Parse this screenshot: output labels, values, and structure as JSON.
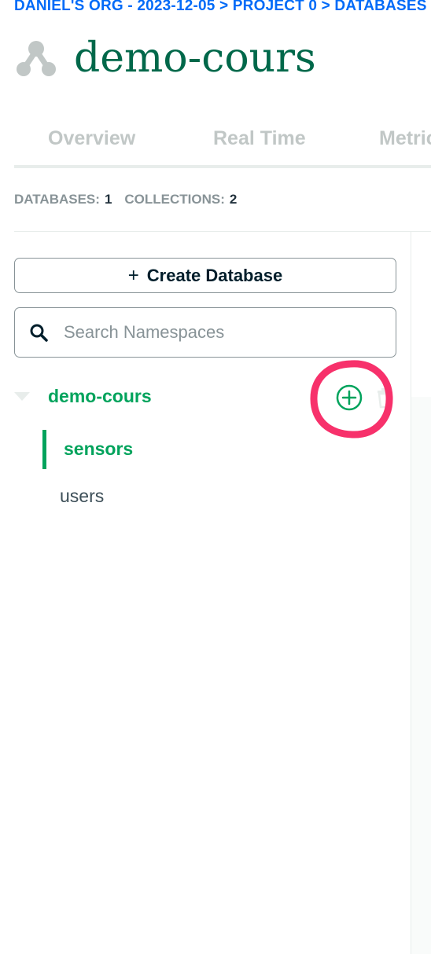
{
  "breadcrumb": "DANIEL'S ORG - 2023-12-05 > PROJECT 0 > DATABASES",
  "cluster": {
    "icon": "cluster-icon",
    "title": "demo-cours"
  },
  "tabs": [
    {
      "label": "Overview"
    },
    {
      "label": "Real Time"
    },
    {
      "label": "Metrics"
    }
  ],
  "stats": {
    "databases_label": "DATABASES:",
    "databases_count": "1",
    "collections_label": "COLLECTIONS:",
    "collections_count": "2"
  },
  "sidebar": {
    "create_database_label": "Create Database",
    "search": {
      "placeholder": "Search Namespaces",
      "value": ""
    },
    "databases": [
      {
        "name": "demo-cours",
        "expanded": true,
        "collections": [
          {
            "name": "sensors",
            "active": true
          },
          {
            "name": "users",
            "active": false
          }
        ]
      }
    ]
  },
  "colors": {
    "brand_green": "#00a35c",
    "title_green": "#00684a",
    "link_blue": "#016bf8",
    "highlight_pink": "#f7316b"
  }
}
